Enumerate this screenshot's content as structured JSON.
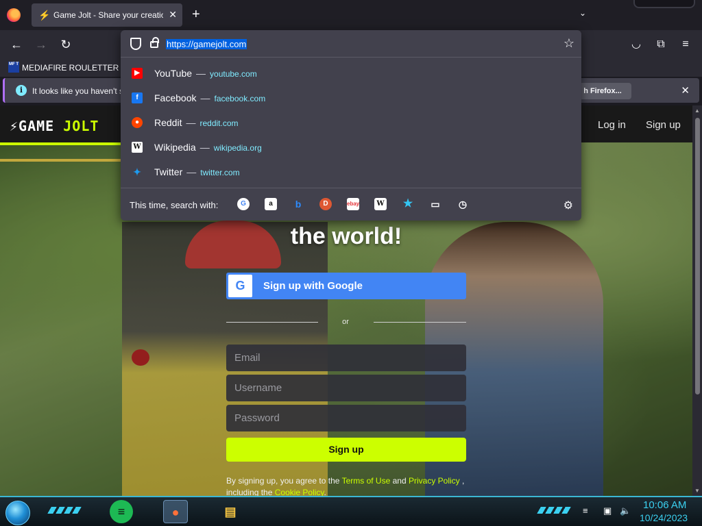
{
  "browser": {
    "tab_title": "Game Jolt - Share your creations",
    "new_tab_label": "+",
    "url": "https://gamejolt.com",
    "bookmark_label": "MEDIAFIRE ROULETTER",
    "bookmark_icon_text": "MF T",
    "notification_text": "It looks like you haven't s",
    "notification_button": "h Firefox..."
  },
  "url_suggestions": [
    {
      "name": "YouTube",
      "url": "youtube.com",
      "icon": "youtube-icon",
      "color": "#ff0000"
    },
    {
      "name": "Facebook",
      "url": "facebook.com",
      "icon": "facebook-icon",
      "color": "#1877f2"
    },
    {
      "name": "Reddit",
      "url": "reddit.com",
      "icon": "reddit-icon",
      "color": "#ff4500"
    },
    {
      "name": "Wikipedia",
      "url": "wikipedia.org",
      "icon": "wikipedia-icon",
      "color": "#ffffff"
    },
    {
      "name": "Twitter",
      "url": "twitter.com",
      "icon": "twitter-icon",
      "color": "#1d9bf0"
    }
  ],
  "separator": "—",
  "search_with_label": "This time, search with:",
  "search_engines": [
    "google-icon",
    "amazon-icon",
    "bing-icon",
    "duckduckgo-icon",
    "ebay-icon",
    "wikipedia-icon",
    "bookmarks-icon",
    "tabs-icon",
    "history-icon"
  ],
  "gamejolt": {
    "logo_game": "GAME",
    "logo_jolt": "JOLT",
    "login": "Log in",
    "signup": "Sign up",
    "hero": "the world!",
    "google_button": "Sign up with Google",
    "or": "or",
    "email_placeholder": "Email",
    "username_placeholder": "Username",
    "password_placeholder": "Password",
    "signup_button": "Sign up",
    "terms_prefix": "By signing up, you agree to the",
    "terms_link": "Terms of Use",
    "terms_and": "and",
    "privacy_link": "Privacy Policy",
    "terms_comma": ",",
    "terms_including": "including the",
    "cookie_link": "Cookie Policy",
    "terms_end": "."
  },
  "taskbar": {
    "time": "10:06 AM",
    "date": "10/24/2023"
  },
  "colors": {
    "accent_lime": "#ccff00",
    "google_blue": "#4285f4",
    "url_link": "#80ebff"
  }
}
